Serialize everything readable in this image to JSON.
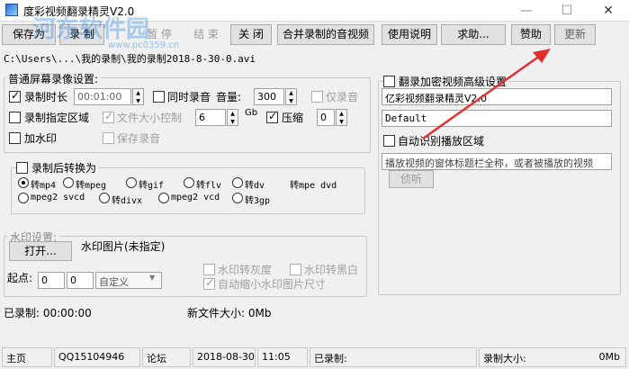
{
  "window": {
    "title": "度彩视频翻录精灵V2.0",
    "min": "—",
    "max": "☐",
    "close": "✕"
  },
  "watermark": {
    "text": "河东软件园",
    "url": "www.pc0359.cn"
  },
  "toolbar": {
    "save_as": "保存为",
    "record": "录 制",
    "pause": "暂 停",
    "stop": "结 束",
    "close": "关 闭",
    "merge": "合并录制的音视频",
    "manual": "使用说明",
    "help": "求助...",
    "sponsor": "赞助",
    "update": "更新"
  },
  "path": "C:\\Users\\...\\我的录制\\我的录制2018-8-30-0.avi",
  "settings": {
    "group_title": "普通屏幕录像设置:",
    "duration_label": "录制时长",
    "duration_value": "00:01:00",
    "sync_audio_label": "同时录音",
    "volume_label": "音量:",
    "volume_value": "300",
    "audio_only_label": "仅录音",
    "region_label": "录制指定区域",
    "filesize_label": "文件大小控制",
    "filesize_value": "6",
    "filesize_unit": "Gb",
    "compress_label": "压缩",
    "compress_value": "0",
    "watermark_label": "加水印",
    "save_audio_label": "保存录音"
  },
  "convert": {
    "group_title": "录制后转换为",
    "options": [
      "转mp4",
      "转mpeg",
      "转gif",
      "转flv",
      "转dv",
      "转mpe dvd",
      "mpeg2 svcd",
      "转divx",
      "mpeg2 vcd",
      "转3gp"
    ]
  },
  "watermark_settings": {
    "group_title": "水印设置:",
    "open_button": "打开...",
    "image_label": "水印图片(未指定)",
    "origin_label": "起点:",
    "x_value": "0",
    "y_value": "0",
    "mode_value": "自定义",
    "gray_label": "水印转灰度",
    "bw_label": "水印转黑白",
    "autoscale_label": "自动缩小水印图片尺寸"
  },
  "advanced": {
    "title": "翻录加密视频高级设置",
    "field1": "亿彩视频翻录精灵V2.0",
    "field2": "Default",
    "auto_detect_label": "自动识别播放区域",
    "hint": "播放视频的窗体标题栏全称，或者被播放的视频",
    "detect_button": "侦听"
  },
  "info": {
    "recorded": "已录制:   00:00:00",
    "new_size": "新文件大小:   0Mb"
  },
  "statusbar": {
    "home": "主页",
    "qq": "QQ15104946",
    "forum": "论坛",
    "date": "2018-08-30",
    "time": "11:05",
    "recorded": "已录制:",
    "size": "录制大小:",
    "size_value": "0Mb"
  },
  "colors": {
    "arrow": "#e03030",
    "watermark": "#2882dc"
  }
}
